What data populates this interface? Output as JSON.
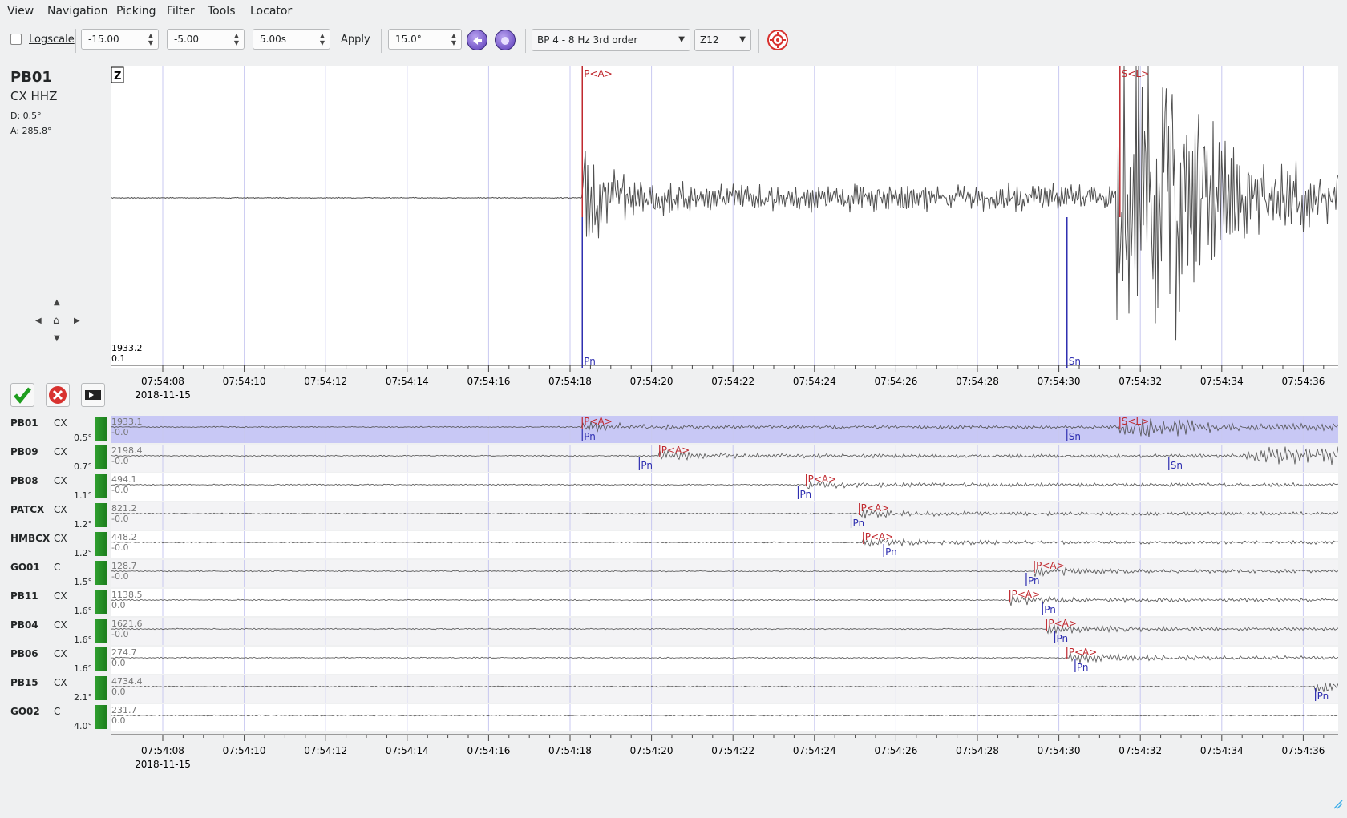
{
  "menu": [
    "View",
    "Navigation",
    "Picking",
    "Filter",
    "Tools",
    "Locator"
  ],
  "toolbar": {
    "logscale_label": "Logscale",
    "min_value": "-15.00",
    "max_value": "-5.00",
    "length_value": "5.00s",
    "apply_label": "Apply",
    "angle_value": "15.0°",
    "filter_value": "BP 4 - 8 Hz  3rd order",
    "rotation_value": "Z12"
  },
  "main": {
    "station": "PB01",
    "network_channel": "CX  HHZ",
    "distance": "D:  0.5°",
    "azimuth": "A:  285.8°",
    "component_badge": "Z",
    "amp_max": "1933.2",
    "amp_min": "0.1",
    "picks": [
      {
        "label": "P<A>",
        "time": 18.3,
        "type": "manual"
      },
      {
        "label": "S<L>",
        "time": 31.5,
        "type": "manual"
      },
      {
        "label": "Pn",
        "time": 18.3,
        "type": "theoretical"
      },
      {
        "label": "Sn",
        "time": 30.2,
        "type": "theoretical"
      }
    ]
  },
  "time_axis": {
    "ticks": [
      "07:54:08",
      "07:54:10",
      "07:54:12",
      "07:54:14",
      "07:54:16",
      "07:54:18",
      "07:54:20",
      "07:54:22",
      "07:54:24",
      "07:54:26",
      "07:54:28",
      "07:54:30",
      "07:54:32",
      "07:54:34",
      "07:54:36"
    ],
    "tick_seconds": [
      8,
      10,
      12,
      14,
      16,
      18,
      20,
      22,
      24,
      26,
      28,
      30,
      32,
      34,
      36
    ],
    "date": "2018-11-15"
  },
  "stations": [
    {
      "name": "PB01",
      "net": "CX",
      "dist": "0.5°",
      "amp_max": "1933.1",
      "amp_min": "-0.0",
      "p": 18.3,
      "pn": 18.3,
      "s": 31.5,
      "sn": 30.2,
      "selected": true
    },
    {
      "name": "PB09",
      "net": "CX",
      "dist": "0.7°",
      "amp_max": "2198.4",
      "amp_min": "-0.0",
      "p": 20.2,
      "pn": 19.7,
      "sn": 32.7
    },
    {
      "name": "PB08",
      "net": "CX",
      "dist": "1.1°",
      "amp_max": "494.1",
      "amp_min": "-0.0",
      "p": 23.8,
      "pn": 23.6
    },
    {
      "name": "PATCX",
      "net": "CX",
      "dist": "1.2°",
      "amp_max": "821.2",
      "amp_min": "-0.0",
      "p": 25.1,
      "pn": 24.9
    },
    {
      "name": "HMBCX",
      "net": "CX",
      "dist": "1.2°",
      "amp_max": "448.2",
      "amp_min": "-0.0",
      "p": 25.2,
      "pn": 25.7
    },
    {
      "name": "GO01",
      "net": "C",
      "dist": "1.5°",
      "amp_max": "128.7",
      "amp_min": "-0.0",
      "p": 29.4,
      "pn": 29.2
    },
    {
      "name": "PB11",
      "net": "CX",
      "dist": "1.6°",
      "amp_max": "1138.5",
      "amp_min": "0.0",
      "p": 28.8,
      "pn": 29.6
    },
    {
      "name": "PB04",
      "net": "CX",
      "dist": "1.6°",
      "amp_max": "1621.6",
      "amp_min": "-0.0",
      "p": 29.7,
      "pn": 29.9
    },
    {
      "name": "PB06",
      "net": "CX",
      "dist": "1.6°",
      "amp_max": "274.7",
      "amp_min": "0.0",
      "p": 30.2,
      "pn": 30.4
    },
    {
      "name": "PB15",
      "net": "CX",
      "dist": "2.1°",
      "amp_max": "4734.4",
      "amp_min": "0.0",
      "pn": 36.3
    },
    {
      "name": "GO02",
      "net": "C",
      "dist": "4.0°",
      "amp_max": "231.7",
      "amp_min": "0.0"
    }
  ],
  "colors": {
    "manual_pick": "#c0282e",
    "theoretical_pick": "#2e2eb0",
    "gridline": "#c8c8f0",
    "selected_row": "#c8c8f5",
    "trace": "#505050"
  }
}
